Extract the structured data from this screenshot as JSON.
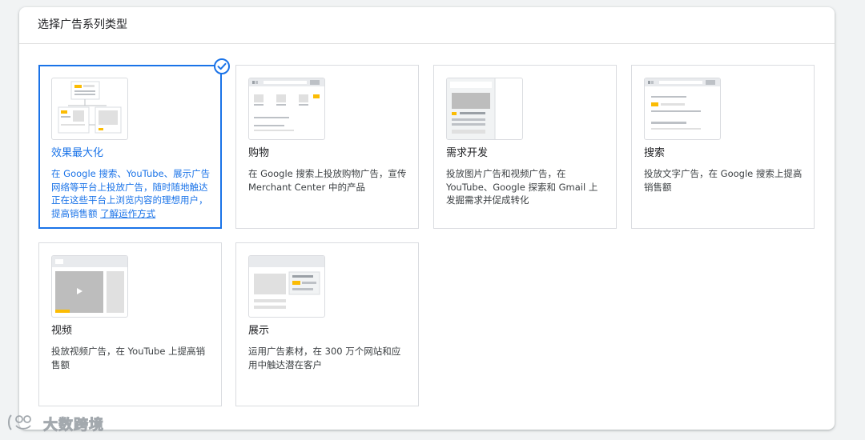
{
  "panel": {
    "title": "选择广告系列类型"
  },
  "cards": [
    {
      "title": "效果最大化",
      "desc": "在 Google 搜索、YouTube、展示广告网络等平台上投放广告，随时随地触达正在这些平台上浏览内容的理想用户，提高销售额",
      "link": "了解运作方式",
      "selected": true
    },
    {
      "title": "购物",
      "desc": "在 Google 搜索上投放购物广告，宣传 Merchant Center 中的产品"
    },
    {
      "title": "需求开发",
      "desc": "投放图片广告和视频广告，在 YouTube、Google 探索和 Gmail 上发掘需求并促成转化"
    },
    {
      "title": "搜索",
      "desc": "投放文字广告，在 Google 搜索上提高销售额"
    },
    {
      "title": "视频",
      "desc": "投放视频广告，在 YouTube 上提高销售额"
    },
    {
      "title": "展示",
      "desc": "运用广告素材，在 300 万个网站和应用中触达潜在客户"
    }
  ],
  "watermark": {
    "text": "大数跨境"
  },
  "colors": {
    "accent": "#1a73e8",
    "ad_yellow": "#fbbc04",
    "border": "#dadce0"
  },
  "icons": {
    "selected": "check-circle-icon"
  }
}
